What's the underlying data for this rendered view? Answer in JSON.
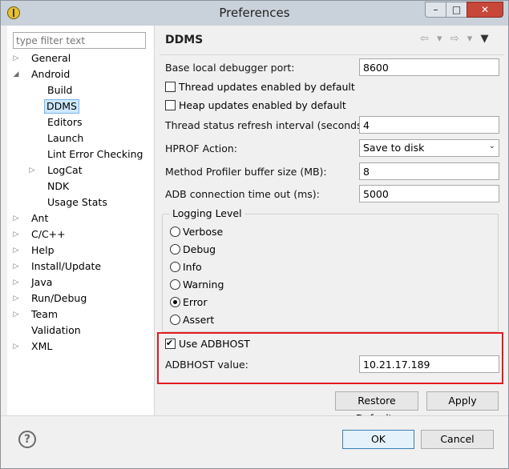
{
  "window": {
    "title": "Preferences",
    "minimize": "–",
    "maximize": "□",
    "close": "✕"
  },
  "nav": {
    "filter_placeholder": "type filter text",
    "items": [
      {
        "label": "General",
        "expander": "▷"
      },
      {
        "label": "Android",
        "expander": "◢"
      },
      {
        "label": "Build"
      },
      {
        "label": "DDMS"
      },
      {
        "label": "Editors"
      },
      {
        "label": "Launch"
      },
      {
        "label": "Lint Error Checking"
      },
      {
        "label": "LogCat",
        "expander": "▷"
      },
      {
        "label": "NDK"
      },
      {
        "label": "Usage Stats"
      },
      {
        "label": "Ant",
        "expander": "▷"
      },
      {
        "label": "C/C++",
        "expander": "▷"
      },
      {
        "label": "Help",
        "expander": "▷"
      },
      {
        "label": "Install/Update",
        "expander": "▷"
      },
      {
        "label": "Java",
        "expander": "▷"
      },
      {
        "label": "Run/Debug",
        "expander": "▷"
      },
      {
        "label": "Team",
        "expander": "▷"
      },
      {
        "label": "Validation"
      },
      {
        "label": "XML",
        "expander": "▷"
      }
    ]
  },
  "page": {
    "title": "DDMS",
    "tools": {
      "back": "⇦",
      "back_menu": "▾",
      "forward": "⇨",
      "forward_menu": "▾",
      "view_menu": "▼"
    },
    "base_port_label": "Base local debugger port:",
    "base_port_value": "8600",
    "thread_updates_label": "Thread updates enabled by default",
    "heap_updates_label": "Heap updates enabled by default",
    "thread_refresh_label": "Thread status refresh interval (seconds):",
    "thread_refresh_value": "4",
    "hprof_label": "HPROF Action:",
    "hprof_value": "Save to disk",
    "profiler_buffer_label": "Method Profiler buffer size (MB):",
    "profiler_buffer_value": "8",
    "adb_timeout_label": "ADB connection time out (ms):",
    "adb_timeout_value": "5000",
    "logging_level_legend": "Logging Level",
    "logging_levels": [
      "Verbose",
      "Debug",
      "Info",
      "Warning",
      "Error",
      "Assert"
    ],
    "selected_logging_level": "Error",
    "use_adbhost_label": "Use ADBHOST",
    "adbhost_value_label": "ADBHOST value:",
    "adbhost_value": "10.21.17.189",
    "restore_defaults": "Restore Defaults",
    "apply": "Apply"
  },
  "footer": {
    "help": "?",
    "ok": "OK",
    "cancel": "Cancel"
  },
  "colors": {
    "highlight_border": "#e21b22",
    "selection_bg": "#cde8ff",
    "close_button": "#c7473a"
  }
}
